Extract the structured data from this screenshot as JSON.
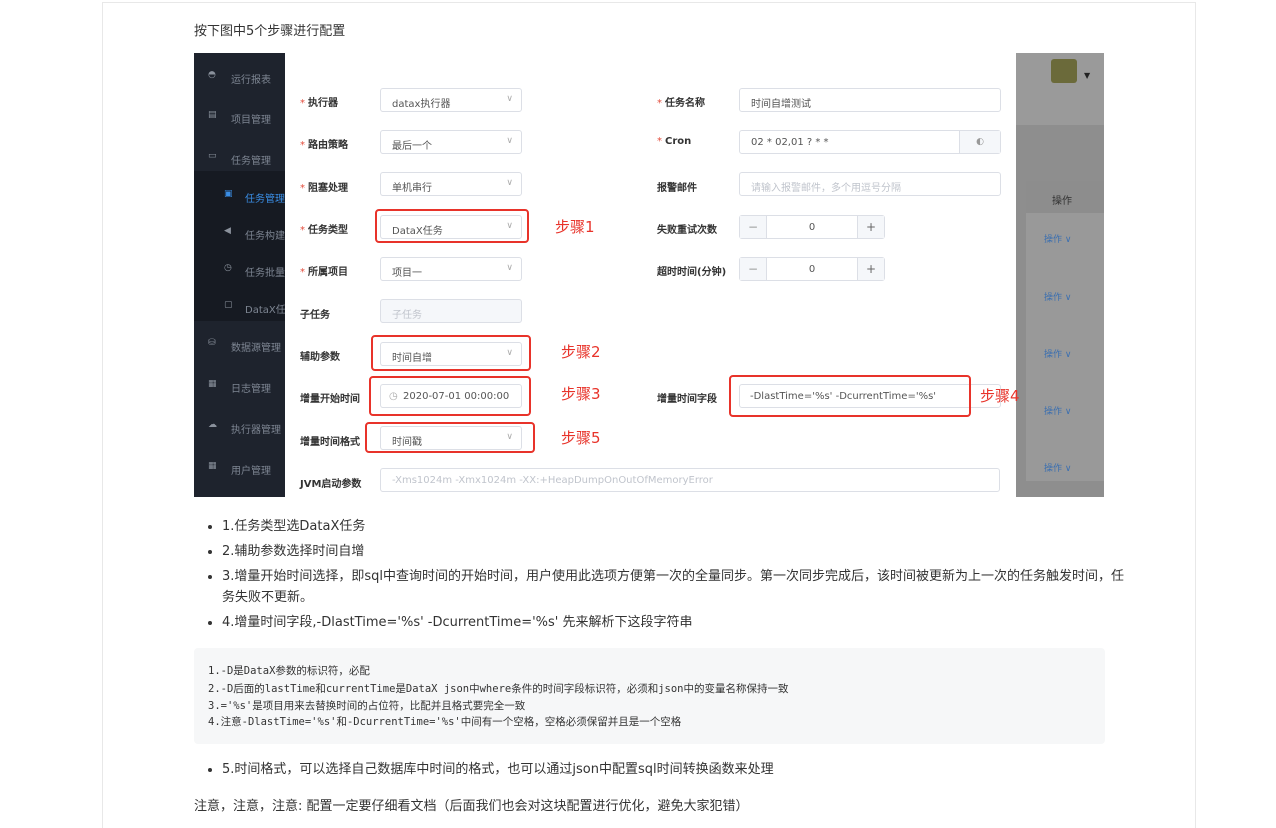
{
  "intro": "按下图中5个步骤进行配置",
  "sidebar": {
    "items": [
      {
        "label": "运行报表",
        "icon": "dashboard-icon"
      },
      {
        "label": "项目管理",
        "icon": "project-icon"
      },
      {
        "label": "任务管理",
        "icon": "monitor-icon"
      },
      {
        "label": "任务管理",
        "icon": "doc-icon",
        "sub": true,
        "active": true
      },
      {
        "label": "任务构建",
        "icon": "send-icon",
        "sub": true
      },
      {
        "label": "任务批量",
        "icon": "clock-icon",
        "sub": true
      },
      {
        "label": "DataX任",
        "icon": "file-icon",
        "sub": true
      },
      {
        "label": "数据源管理",
        "icon": "database-icon"
      },
      {
        "label": "日志管理",
        "icon": "log-icon"
      },
      {
        "label": "执行器管理",
        "icon": "cloud-icon"
      },
      {
        "label": "用户管理",
        "icon": "grid-icon"
      }
    ]
  },
  "overlay": {
    "header": "操作",
    "op_label": "操作 ∨"
  },
  "form": {
    "executor_label": "执行器",
    "executor_value": "datax执行器",
    "task_name_label": "任务名称",
    "task_name_value": "时间自增测试",
    "route_label": "路由策略",
    "route_value": "最后一个",
    "cron_label": "Cron",
    "cron_value": "02 * 02,01 ? * *",
    "block_label": "阻塞处理",
    "block_value": "单机串行",
    "alarm_label": "报警邮件",
    "alarm_placeholder": "请输入报警邮件，多个用逗号分隔",
    "task_type_label": "任务类型",
    "task_type_value": "DataX任务",
    "retry_label": "失败重试次数",
    "retry_value": "0",
    "project_label": "所属项目",
    "project_value": "项目一",
    "timeout_label": "超时时间(分钟)",
    "timeout_value": "0",
    "subtask_label": "子任务",
    "subtask_placeholder": "子任务",
    "aux_label": "辅助参数",
    "aux_value": "时间自增",
    "inc_start_label": "增量开始时间",
    "inc_start_value": "2020-07-01 00:00:00",
    "inc_field_label": "增量时间字段",
    "inc_field_value": "-DlastTime='%s' -DcurrentTime='%s'",
    "inc_format_label": "增量时间格式",
    "inc_format_value": "时间戳",
    "jvm_label": "JVM启动参数",
    "jvm_placeholder": "-Xms1024m -Xmx1024m -XX:+HeapDumpOnOutOfMemoryError"
  },
  "steps": [
    "步骤1",
    "步骤2",
    "步骤3",
    "步骤4",
    "步骤5"
  ],
  "bullets": [
    "1.任务类型选DataX任务",
    "2.辅助参数选择时间自增",
    "3.增量开始时间选择，即sql中查询时间的开始时间，用户使用此选项方便第一次的全量同步。第一次同步完成后，该时间被更新为上一次的任务触发时间，任务失败不更新。",
    "4.增量时间字段,-DlastTime='%s' -DcurrentTime='%s' 先来解析下这段字符串"
  ],
  "code_lines": [
    "1.-D是DataX参数的标识符，必配",
    "2.-D后面的lastTime和currentTime是DataX json中where条件的时间字段标识符，必须和json中的变量名称保持一致",
    "3.='%s'是项目用来去替换时间的占位符，比配并且格式要完全一致",
    "4.注意-DlastTime='%s'和-DcurrentTime='%s'中间有一个空格，空格必须保留并且是一个空格"
  ],
  "bullet5": "5.时间格式，可以选择自己数据库中时间的格式，也可以通过json中配置sql时间转换函数来处理",
  "note": "注意，注意，注意: 配置一定要仔细看文档（后面我们也会对这块配置进行优化，避免大家犯错）"
}
